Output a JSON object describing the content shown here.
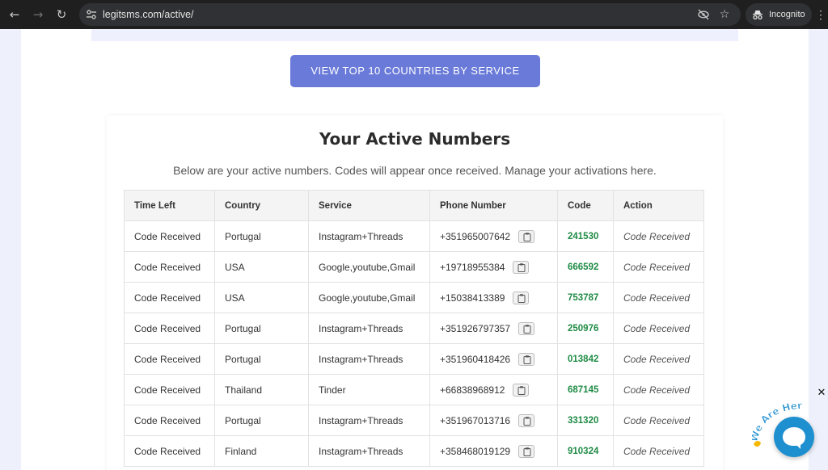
{
  "browser": {
    "url": "legitsms.com/active/",
    "incognito_label": "Incognito"
  },
  "page": {
    "cta_label": "VIEW TOP 10 COUNTRIES BY SERVICE",
    "title": "Your Active Numbers",
    "subtitle": "Below are your active numbers. Codes will appear once received. Manage your activations here."
  },
  "table": {
    "headers": [
      "Time Left",
      "Country",
      "Service",
      "Phone Number",
      "Code",
      "Action"
    ],
    "rows": [
      {
        "time_left": "Code Received",
        "country": "Portugal",
        "service": "Instagram+Threads",
        "phone": "+351965007642",
        "code": "241530",
        "action": "Code Received"
      },
      {
        "time_left": "Code Received",
        "country": "USA",
        "service": "Google,youtube,Gmail",
        "phone": "+19718955384",
        "code": "666592",
        "action": "Code Received"
      },
      {
        "time_left": "Code Received",
        "country": "USA",
        "service": "Google,youtube,Gmail",
        "phone": "+15038413389",
        "code": "753787",
        "action": "Code Received"
      },
      {
        "time_left": "Code Received",
        "country": "Portugal",
        "service": "Instagram+Threads",
        "phone": "+351926797357",
        "code": "250976",
        "action": "Code Received"
      },
      {
        "time_left": "Code Received",
        "country": "Portugal",
        "service": "Instagram+Threads",
        "phone": "+351960418426",
        "code": "013842",
        "action": "Code Received"
      },
      {
        "time_left": "Code Received",
        "country": "Thailand",
        "service": "Tinder",
        "phone": "+66838968912",
        "code": "687145",
        "action": "Code Received"
      },
      {
        "time_left": "Code Received",
        "country": "Portugal",
        "service": "Instagram+Threads",
        "phone": "+351967013716",
        "code": "331320",
        "action": "Code Received"
      },
      {
        "time_left": "Code Received",
        "country": "Finland",
        "service": "Instagram+Threads",
        "phone": "+358468019129",
        "code": "910324",
        "action": "Code Received"
      }
    ]
  },
  "chat_widget": {
    "badge_text": "We Are Here!",
    "close_symbol": "✕"
  },
  "colors": {
    "cta_bg": "#6a7ad8",
    "code_green": "#1f8b45",
    "chat_blue": "#1e8fcf"
  }
}
